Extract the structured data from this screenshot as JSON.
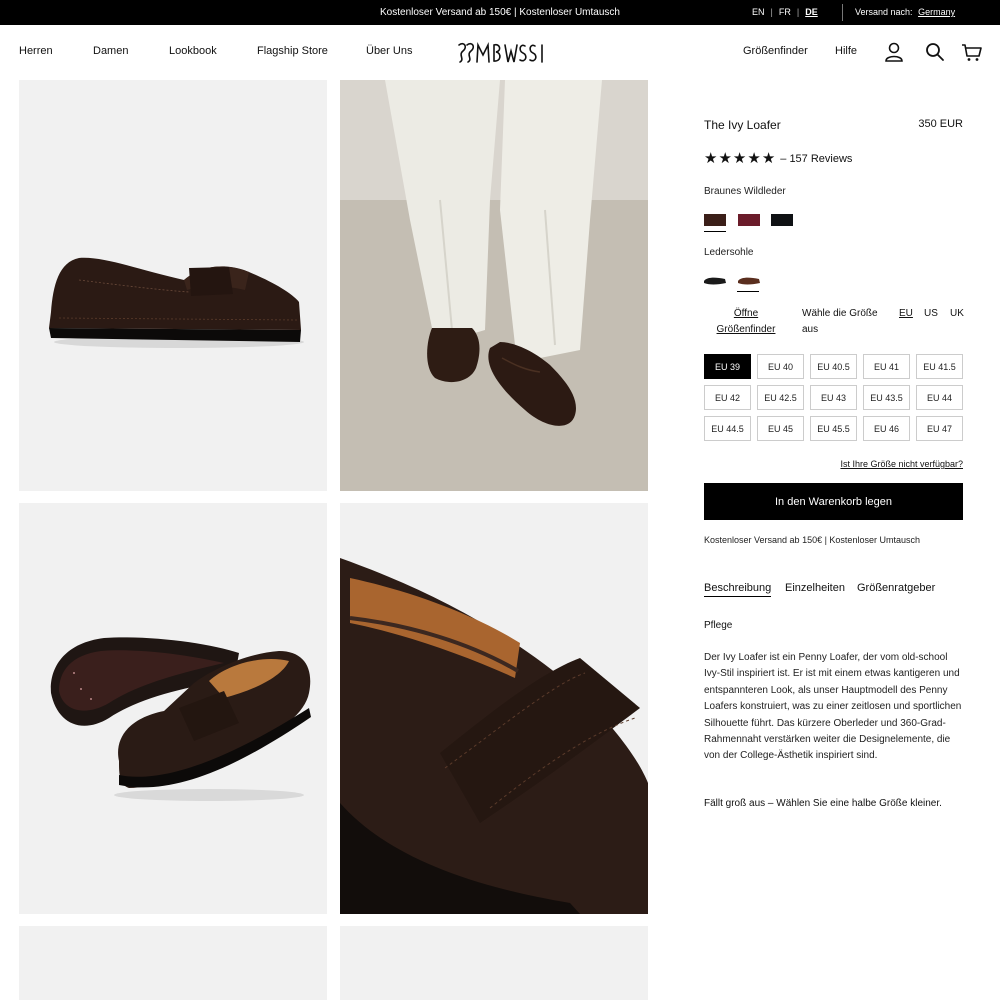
{
  "topbar": {
    "promo": "Kostenloser Versand ab 150€ | Kostenloser Umtausch",
    "languages": [
      {
        "code": "EN",
        "active": false
      },
      {
        "code": "FR",
        "active": false
      },
      {
        "code": "DE",
        "active": true
      }
    ],
    "shipping_label": "Versand nach:",
    "shipping_country": "Germany"
  },
  "nav": {
    "left": [
      "Herren",
      "Damen",
      "Lookbook",
      "Flagship Store",
      "Über Uns"
    ],
    "right": [
      "Größenfinder",
      "Hilfe"
    ],
    "icons": [
      "account-icon",
      "search-icon",
      "cart-icon"
    ]
  },
  "product": {
    "title": "The Ivy Loafer",
    "price": "350 EUR",
    "rating_stars": 5,
    "reviews": "– 157 Reviews",
    "color_label": "Braunes Wildleder",
    "colors": [
      {
        "name": "brown-suede",
        "hex": "#3b1f18",
        "selected": true
      },
      {
        "name": "burgundy",
        "hex": "#6b1c2a",
        "selected": false
      },
      {
        "name": "black",
        "hex": "#0f1114",
        "selected": false
      }
    ],
    "sole_label": "Ledersohle",
    "soles": [
      {
        "name": "black-sole",
        "hex": "#1a1a1a",
        "selected": false
      },
      {
        "name": "brown-sole",
        "hex": "#5a2e1e",
        "selected": true
      }
    ],
    "size_finder_link": "Öffne Größenfinder",
    "choose_size": "Wähle die Größe aus",
    "size_systems": [
      {
        "label": "EU",
        "active": true
      },
      {
        "label": "US",
        "active": false
      },
      {
        "label": "UK",
        "active": false
      }
    ],
    "sizes": [
      "EU 39",
      "EU 40",
      "EU 40.5",
      "EU 41",
      "EU 41.5",
      "EU 42",
      "EU 42.5",
      "EU 43",
      "EU 43.5",
      "EU 44",
      "EU 44.5",
      "EU 45",
      "EU 45.5",
      "EU 46",
      "EU 47"
    ],
    "selected_size": "EU 39",
    "size_unavailable_link": "Ist Ihre Größe nicht verfügbar?",
    "add_to_cart": "In den Warenkorb legen",
    "cart_note": "Kostenloser Versand ab 150€ | Kostenloser Umtausch",
    "tabs": [
      {
        "label": "Beschreibung",
        "active": true
      },
      {
        "label": "Einzelheiten",
        "active": false
      },
      {
        "label": "Größenratgeber",
        "active": false
      }
    ],
    "care_label": "Pflege",
    "description": "Der Ivy Loafer ist ein Penny Loafer, der vom old-school Ivy-Stil inspiriert ist. Er ist mit einem etwas kantigeren und entspannteren Look, als unser Hauptmodell des Penny Loafers konstruiert, was zu einer zeitlosen und sportlichen Silhouette führt. Das kürzere Oberleder und 360-Grad-Rahmennaht verstärken weiter die Designelemente, die von der College-Ästhetik inspiriert sind.",
    "fit_note": "Fällt groß aus – Wählen Sie eine halbe Größe kleiner."
  },
  "gallery": [
    {
      "name": "loafer-side-view"
    },
    {
      "name": "loafer-worn-with-trousers"
    },
    {
      "name": "loafer-pair-with-sole"
    },
    {
      "name": "loafer-detail-closeup"
    },
    {
      "name": "gallery-image-5"
    },
    {
      "name": "gallery-image-6"
    }
  ]
}
